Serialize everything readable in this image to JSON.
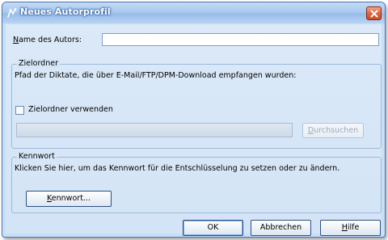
{
  "window": {
    "title": "Neues Autorprofil"
  },
  "author_name": {
    "label_prefix": "N",
    "label_rest": "ame des Autors:",
    "value": ""
  },
  "target_folder": {
    "group_title": "Zielordner",
    "description": "Pfad der Diktate, die über E-Mail/FTP/DPM-Download empfangen wurden:",
    "checkbox_label": "Zielordner verwenden",
    "checkbox_checked": false,
    "path_value": "",
    "browse_label_prefix": "D",
    "browse_label_rest": "urchsuchen"
  },
  "password": {
    "group_title": "Kennwort",
    "description": "Klicken Sie hier, um das Kennwort für die Entschlüsselung zu setzen oder zu ändern.",
    "button_label_prefix": "K",
    "button_label_rest": "ennwort..."
  },
  "footer": {
    "ok_label": "OK",
    "cancel_label": "Abbrechen",
    "help_label_prefix": "H",
    "help_label_rest": "ilfe"
  },
  "colors": {
    "title_bar": "#a9c9ee",
    "client_bg": "#d7e6f7",
    "close_button": "#e2643e"
  },
  "icons": {
    "title": "app-icon",
    "close": "close-icon"
  }
}
